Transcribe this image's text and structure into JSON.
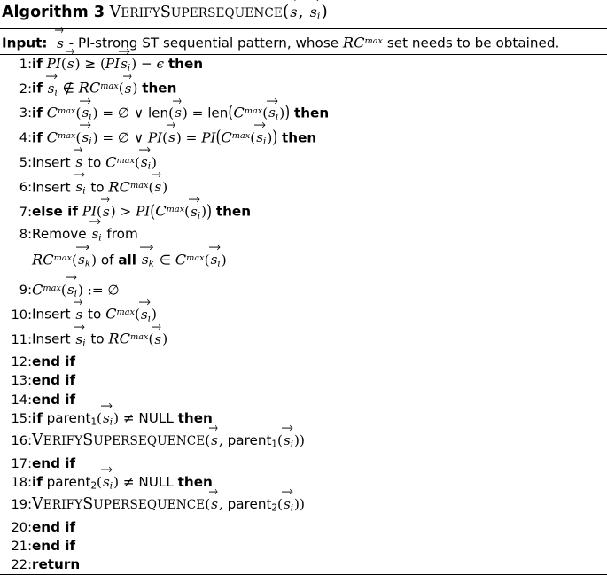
{
  "header": {
    "algorithm_label": "Algorithm",
    "algorithm_number": "3",
    "procedure_name": "VerifySupersequence",
    "procedure_args": "(s⃗, s⃗i)"
  },
  "input": {
    "label": "Input:",
    "text": "s⃗ - PI-strong ST sequential pattern, whose RC^max set needs to be obtained."
  },
  "lines": [
    {
      "num": "1:",
      "indent": 0,
      "text": "if PI(s⃗) ≥ (PI s⃗i) − ϵ then"
    },
    {
      "num": "2:",
      "indent": 1,
      "text": "if s⃗i ∉ RC^max(s⃗) then"
    },
    {
      "num": "3:",
      "indent": 2,
      "text": "if C^max(s⃗i) = ∅ ∨ len(s⃗) = len(C^max(s⃗i)) then"
    },
    {
      "num": "4:",
      "indent": 3,
      "text": "if C^max(s⃗i) = ∅ ∨ PI(s⃗) = PI(C^max(s⃗i)) then"
    },
    {
      "num": "5:",
      "indent": 4,
      "text": "Insert s⃗ to C^max(s⃗i)"
    },
    {
      "num": "6:",
      "indent": 4,
      "text": "Insert s⃗i to RC^max(s⃗)"
    },
    {
      "num": "7:",
      "indent": 3,
      "text": "else if PI(s⃗) > PI(C^max(s⃗i)) then"
    },
    {
      "num": "8:",
      "indent": 4,
      "text": "Remove s⃗i from"
    },
    {
      "num": "",
      "indent": 5,
      "text": "RC^max(s⃗k) of all s⃗k ∈ C^max(s⃗i)"
    },
    {
      "num": "9:",
      "indent": 4,
      "text": "C^max(s⃗i) := ∅"
    },
    {
      "num": "10:",
      "indent": 4,
      "text": "Insert s⃗ to C^max(s⃗i)"
    },
    {
      "num": "11:",
      "indent": 4,
      "text": "Insert s⃗i to RC^max(s⃗)"
    },
    {
      "num": "12:",
      "indent": 3,
      "text": "end if"
    },
    {
      "num": "13:",
      "indent": 2,
      "text": "end if"
    },
    {
      "num": "14:",
      "indent": 1,
      "text": "end if"
    },
    {
      "num": "15:",
      "indent": 1,
      "text": "if parent1(s⃗i) ≠ NULL then"
    },
    {
      "num": "16:",
      "indent": 2,
      "text": "VerifySupersequence(s⃗, parent1(s⃗i))"
    },
    {
      "num": "17:",
      "indent": 1,
      "text": "end if"
    },
    {
      "num": "18:",
      "indent": 1,
      "text": "if parent2(s⃗i) ≠ NULL then"
    },
    {
      "num": "19:",
      "indent": 2,
      "text": "VerifySupersequence(s⃗, parent2(s⃗i))"
    },
    {
      "num": "20:",
      "indent": 1,
      "text": "end if"
    },
    {
      "num": "21:",
      "indent": 0,
      "text": "end if"
    },
    {
      "num": "22:",
      "indent": 0,
      "text": "return"
    }
  ],
  "keywords": {
    "if": "if",
    "then": "then",
    "else_if": "else if",
    "end_if": "end if",
    "return": "return",
    "all": "all",
    "insert": "Insert",
    "remove": "Remove",
    "to": "to",
    "from": "from",
    "of": "of",
    "null": "NULL",
    "len": "len",
    "parent": "parent",
    "sub1": "1",
    "sub2": "2",
    "assign": ":=",
    "max": "max"
  },
  "symbols": {
    "geq": "≥",
    "gt": ">",
    "eq": "=",
    "neq": "≠",
    "notin": "∉",
    "in": "∈",
    "emptyset": "∅",
    "or": "∨",
    "minus": "−",
    "epsilon": "ϵ",
    "comma": ","
  },
  "identifiers": {
    "PI": "PI",
    "C": "C",
    "RC": "RC",
    "s": "s",
    "i": "i",
    "k": "k"
  }
}
